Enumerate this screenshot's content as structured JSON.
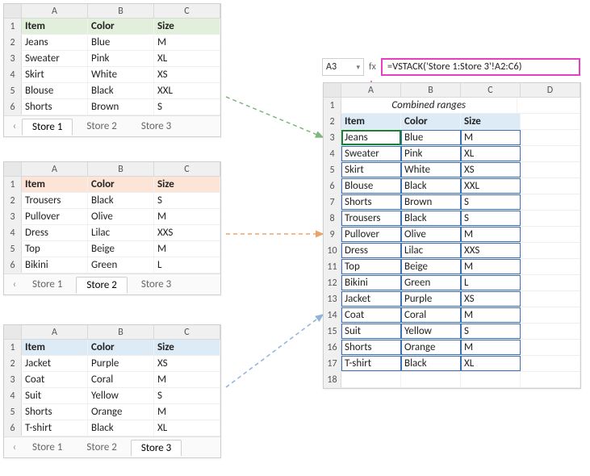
{
  "headers": {
    "item": "Item",
    "color": "Color",
    "size": "Size"
  },
  "cols": [
    "A",
    "B",
    "C"
  ],
  "cols_combined": [
    "A",
    "B",
    "C",
    "D"
  ],
  "rownums": [
    "1",
    "2",
    "3",
    "4",
    "5",
    "6"
  ],
  "store1": [
    {
      "item": "Jeans",
      "color": "Blue",
      "size": "M"
    },
    {
      "item": "Sweater",
      "color": "Pink",
      "size": "XL"
    },
    {
      "item": "Skirt",
      "color": "White",
      "size": "XS"
    },
    {
      "item": "Blouse",
      "color": "Black",
      "size": "XXL"
    },
    {
      "item": "Shorts",
      "color": "Brown",
      "size": "S"
    }
  ],
  "store2": [
    {
      "item": "Trousers",
      "color": "Black",
      "size": "S"
    },
    {
      "item": "Pullover",
      "color": "Olive",
      "size": "M"
    },
    {
      "item": "Dress",
      "color": "Lilac",
      "size": "XXS"
    },
    {
      "item": "Top",
      "color": "Beige",
      "size": "M"
    },
    {
      "item": "Bikini",
      "color": "Green",
      "size": "L"
    }
  ],
  "store3": [
    {
      "item": "Jacket",
      "color": "Purple",
      "size": "XS"
    },
    {
      "item": "Coat",
      "color": "Coral",
      "size": "M"
    },
    {
      "item": "Suit",
      "color": "Yellow",
      "size": "S"
    },
    {
      "item": "Shorts",
      "color": "Orange",
      "size": "M"
    },
    {
      "item": "T-shirt",
      "color": "Black",
      "size": "XL"
    }
  ],
  "tabs": {
    "nav_prev": "‹",
    "nav_next": "›",
    "s1": "Store 1",
    "s2": "Store 2",
    "s3": "Store 3"
  },
  "combined": {
    "namebox": "A3",
    "fx": "fx",
    "formula": "=VSTACK('Store 1:Store 3'!A2:C6)",
    "title": "Combined ranges",
    "rownums": [
      "1",
      "2",
      "3",
      "4",
      "5",
      "6",
      "7",
      "8",
      "9",
      "10",
      "11",
      "12",
      "13",
      "14",
      "15",
      "16",
      "17",
      "18"
    ]
  },
  "chart_data": {
    "type": "table",
    "title": "Combined ranges",
    "formula": "=VSTACK('Store 1:Store 3'!A2:C6)",
    "columns": [
      "Item",
      "Color",
      "Size"
    ],
    "rows": [
      [
        "Jeans",
        "Blue",
        "M"
      ],
      [
        "Sweater",
        "Pink",
        "XL"
      ],
      [
        "Skirt",
        "White",
        "XS"
      ],
      [
        "Blouse",
        "Black",
        "XXL"
      ],
      [
        "Shorts",
        "Brown",
        "S"
      ],
      [
        "Trousers",
        "Black",
        "S"
      ],
      [
        "Pullover",
        "Olive",
        "M"
      ],
      [
        "Dress",
        "Lilac",
        "XXS"
      ],
      [
        "Top",
        "Beige",
        "M"
      ],
      [
        "Bikini",
        "Green",
        "L"
      ],
      [
        "Jacket",
        "Purple",
        "XS"
      ],
      [
        "Coat",
        "Coral",
        "M"
      ],
      [
        "Suit",
        "Yellow",
        "S"
      ],
      [
        "Shorts",
        "Orange",
        "M"
      ],
      [
        "T-shirt",
        "Black",
        "XL"
      ]
    ]
  }
}
